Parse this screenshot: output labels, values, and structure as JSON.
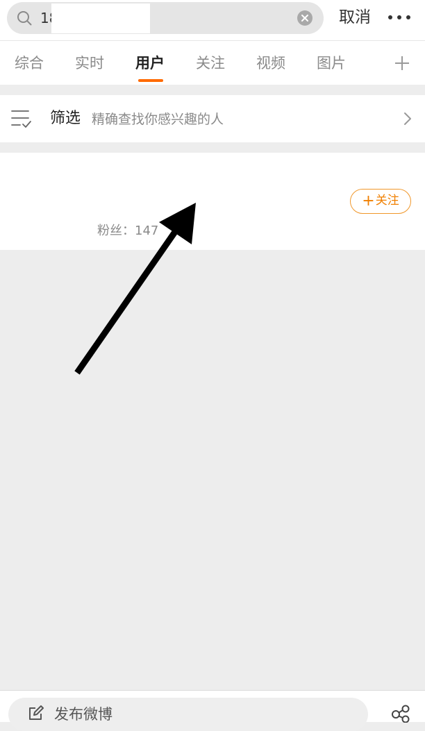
{
  "search": {
    "query": "18",
    "cancel_label": "取消"
  },
  "tabs": [
    {
      "label": "综合",
      "active": false
    },
    {
      "label": "实时",
      "active": false
    },
    {
      "label": "用户",
      "active": true
    },
    {
      "label": "关注",
      "active": false
    },
    {
      "label": "视频",
      "active": false
    },
    {
      "label": "图片",
      "active": false
    }
  ],
  "filter": {
    "title": "筛选",
    "description": "精确查找你感兴趣的人"
  },
  "user_result": {
    "follow_label": "关注",
    "fans_text": "粉丝：147"
  },
  "bottom": {
    "compose_label": "发布微博"
  },
  "colors": {
    "accent": "#ff6a00",
    "follow": "#f07f00",
    "background": "#ededed"
  }
}
